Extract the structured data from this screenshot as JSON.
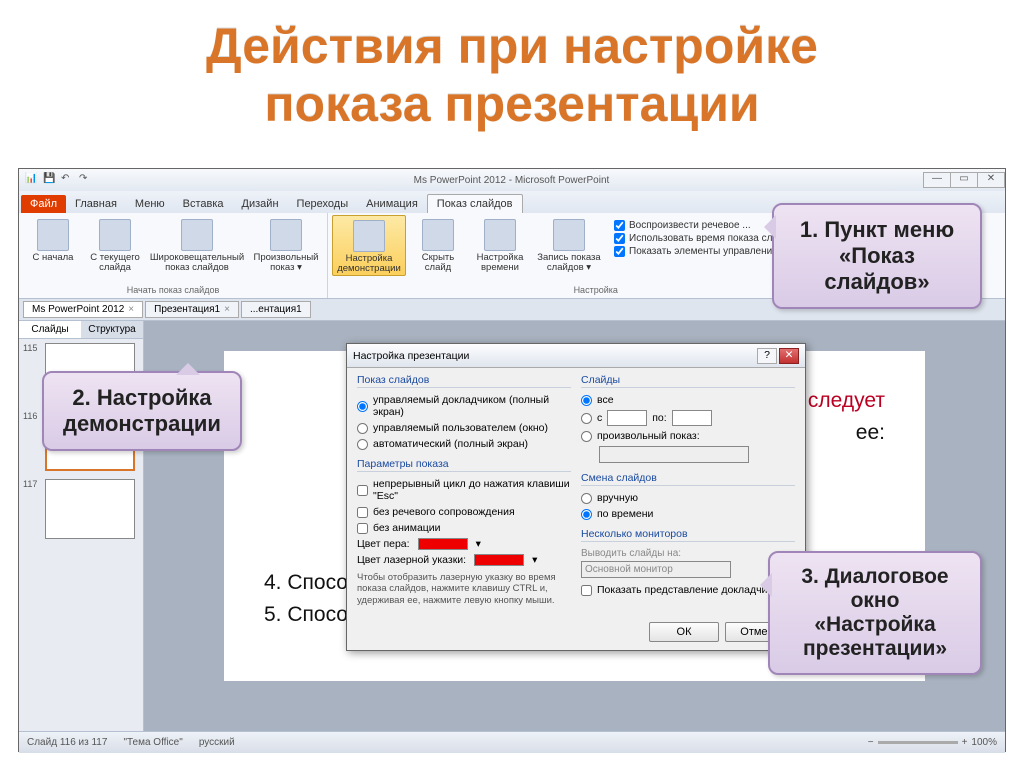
{
  "title_line1": "Действия при настройке",
  "title_line2": "показа презентации",
  "window_title": "Ms PowerPoint 2012  -  Microsoft PowerPoint",
  "tabs": {
    "file": "Файл",
    "home": "Главная",
    "menu": "Меню",
    "insert": "Вставка",
    "design": "Дизайн",
    "transitions": "Переходы",
    "animations": "Анимация",
    "slideshow": "Показ слайдов"
  },
  "ribbon": {
    "from_start": "С начала",
    "from_current": "С текущего слайда",
    "broadcast": "Широковещательный показ слайдов",
    "custom": "Произвольный показ ▾",
    "setup": "Настройка демонстрации",
    "hide": "Скрыть слайд",
    "rehearse": "Настройка времени",
    "record": "Запись показа слайдов ▾",
    "group_start": "Начать показ слайдов",
    "group_setup": "Настройка",
    "chk_narration": "Воспроизвести речевое ...",
    "chk_timings": "Использовать время показа слайдов",
    "chk_controls": "Показать элементы управления проигрывателем"
  },
  "doc_tabs": {
    "t1": "Ms PowerPoint 2012",
    "t2": "Презентация1",
    "t3": "...ентация1"
  },
  "panel": {
    "slides": "Слайды",
    "outline": "Структура"
  },
  "slide_nums": {
    "n1": "115",
    "n2": "116",
    "n3": "117"
  },
  "slide_text": {
    "l1_suffix": "тации следует",
    "l2_suffix": "ее:",
    "l4": "4.   Способ смены слайдов.",
    "l5": "5.   Способ смены слайдов."
  },
  "status": {
    "slide": "Слайд 116 из 117",
    "theme": "\"Тема Office\"",
    "lang": "русский",
    "zoom": "100%"
  },
  "dialog": {
    "title": "Настройка презентации",
    "sec_show": "Показ слайдов",
    "r_presenter": "управляемый докладчиком (полный экран)",
    "r_user": "управляемый пользователем (окно)",
    "r_auto": "автоматический (полный экран)",
    "sec_options": "Параметры показа",
    "c_loop": "непрерывный цикл до нажатия клавиши \"Esc\"",
    "c_no_narration": "без речевого сопровождения",
    "c_no_anim": "без анимации",
    "pen_color": "Цвет пера:",
    "laser_color": "Цвет лазерной указки:",
    "sec_slides": "Слайды",
    "r_all": "все",
    "r_from": "с",
    "r_to": "по:",
    "r_custom": "произвольный показ:",
    "sec_advance": "Смена слайдов",
    "r_manual": "вручную",
    "r_timed": "по времени",
    "sec_monitors": "Несколько мониторов",
    "mon_label": "Выводить слайды на:",
    "mon_value": "Основной монитор",
    "c_presenter_view": "Показать представление докладчика",
    "note": "Чтобы отобразить лазерную указку во время показа слайдов, нажмите клавишу CTRL и, удерживая ее, нажмите левую кнопку мыши.",
    "ok": "ОК",
    "cancel": "Отмена"
  },
  "callouts": {
    "c1": "1. Пункт меню «Показ слайдов»",
    "c2": "2. Настройка демонстрации",
    "c3": "3. Диалоговое окно «Настройка презентации»"
  }
}
